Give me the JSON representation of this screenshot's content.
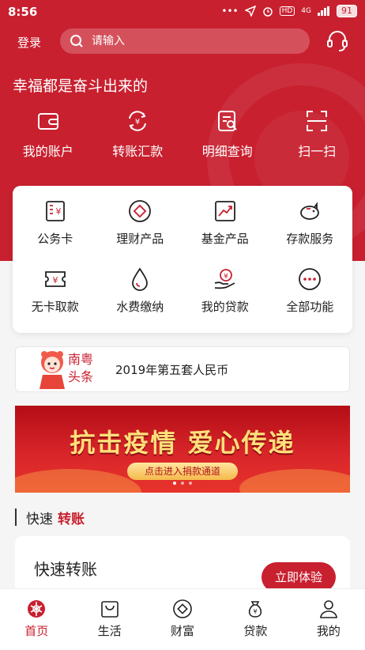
{
  "status": {
    "time": "8:56",
    "icons": "••• ",
    "net": "4G",
    "hd": "HD",
    "battery": "91"
  },
  "header": {
    "login": "登录",
    "search_placeholder": "请输入",
    "slogan": "幸福都是奋斗出来的"
  },
  "quick_actions": [
    {
      "label": "我的账户",
      "icon": "wallet-icon"
    },
    {
      "label": "转账汇款",
      "icon": "transfer-yen-icon"
    },
    {
      "label": "明细查询",
      "icon": "statement-search-icon"
    },
    {
      "label": "扫一扫",
      "icon": "scan-icon"
    }
  ],
  "services": [
    {
      "label": "公务卡",
      "icon": "official-card-icon"
    },
    {
      "label": "理财产品",
      "icon": "finance-product-icon"
    },
    {
      "label": "基金产品",
      "icon": "fund-chart-icon"
    },
    {
      "label": "存款服务",
      "icon": "piggy-bank-icon"
    },
    {
      "label": "无卡取款",
      "icon": "cardless-withdraw-icon"
    },
    {
      "label": "水费缴纳",
      "icon": "water-drop-icon"
    },
    {
      "label": "我的贷款",
      "icon": "loan-hand-icon"
    },
    {
      "label": "全部功能",
      "icon": "more-dots-icon"
    }
  ],
  "news": {
    "brand_line1": "南粤",
    "brand_line2": "头条",
    "headline": "2019年第五套人民币"
  },
  "banner": {
    "title": "抗击疫情 爱心传递",
    "button": "点击进入捐款通道"
  },
  "section": {
    "title_plain": "快速",
    "title_accent": "转账"
  },
  "transfer_card": {
    "title": "快速转账",
    "subtitle": "",
    "button": "立即体验"
  },
  "tabs": [
    {
      "label": "首页",
      "icon": "home-emblem-icon",
      "active": true
    },
    {
      "label": "生活",
      "icon": "shopping-bag-icon"
    },
    {
      "label": "财富",
      "icon": "wealth-icon"
    },
    {
      "label": "贷款",
      "icon": "loan-bag-icon"
    },
    {
      "label": "我的",
      "icon": "user-icon"
    }
  ],
  "colors": {
    "brand": "#c8202f",
    "accent_gold": "#ffe07a"
  }
}
